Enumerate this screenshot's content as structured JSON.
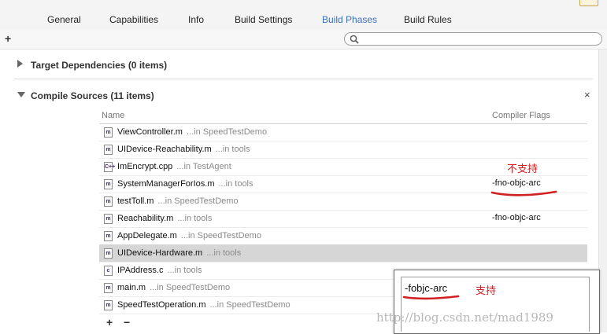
{
  "tabs": [
    {
      "label": "General"
    },
    {
      "label": "Capabilities"
    },
    {
      "label": "Info"
    },
    {
      "label": "Build Settings"
    },
    {
      "label": "Build Phases"
    },
    {
      "label": "Build Rules"
    }
  ],
  "active_tab": "Build Phases",
  "toolbar": {
    "add_symbol": "+",
    "search_value": "",
    "search_placeholder": ""
  },
  "sections": {
    "target_dependencies": {
      "label": "Target Dependencies (0 items)"
    },
    "compile_sources": {
      "label": "Compile Sources (11 items)",
      "close_symbol": "×"
    }
  },
  "table": {
    "columns": [
      "Name",
      "Compiler Flags"
    ],
    "rows": [
      {
        "icon": "m",
        "name": "ViewController.m",
        "path": "...in SpeedTestDemo",
        "flags": ""
      },
      {
        "icon": "m",
        "name": "UIDevice-Reachability.m",
        "path": "...in tools",
        "flags": ""
      },
      {
        "icon": "C++",
        "name": "ImEncrypt.cpp",
        "path": "...in TestAgent",
        "flags": ""
      },
      {
        "icon": "m",
        "name": "SystemManagerForIos.m",
        "path": "...in tools",
        "flags": "-fno-objc-arc"
      },
      {
        "icon": "m",
        "name": "testToll.m",
        "path": "...in SpeedTestDemo",
        "flags": ""
      },
      {
        "icon": "m",
        "name": "Reachability.m",
        "path": "...in tools",
        "flags": "-fno-objc-arc"
      },
      {
        "icon": "m",
        "name": "AppDelegate.m",
        "path": "...in SpeedTestDemo",
        "flags": ""
      },
      {
        "icon": "m",
        "name": "UIDevice-Hardware.m",
        "path": "...in tools",
        "flags": "",
        "selected": true
      },
      {
        "icon": "c",
        "name": "IPAddress.c",
        "path": "...in tools",
        "flags": ""
      },
      {
        "icon": "m",
        "name": "main.m",
        "path": "...in SpeedTestDemo",
        "flags": ""
      },
      {
        "icon": "m",
        "name": "SpeedTestOperation.m",
        "path": "...in SpeedTestDemo",
        "flags": ""
      }
    ]
  },
  "bottom": {
    "add_symbol": "+",
    "remove_symbol": "−"
  },
  "popup": {
    "text": "-fobjc-arc"
  },
  "annotations": {
    "not_supported": "不支持",
    "supported": "支持"
  },
  "watermark": "http://blog.csdn.net/mad1989",
  "colors": {
    "active_tab": "#3a6fb8",
    "annotation_red": "#d12020",
    "selected_row": "#d6d6d6"
  }
}
